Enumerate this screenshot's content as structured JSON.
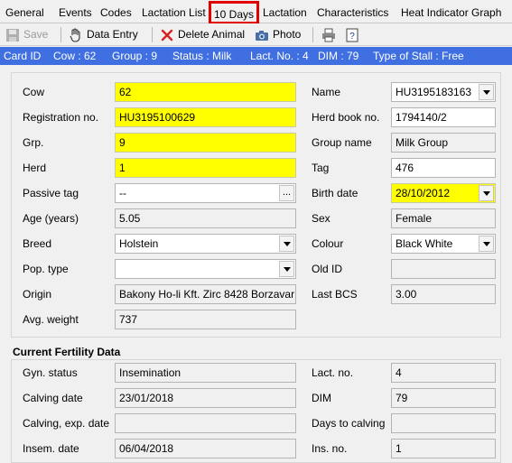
{
  "tabs": [
    "General",
    "Events",
    "Codes",
    "Lactation List",
    "10 Days",
    "Lactation",
    "Characteristics",
    "Heat Indicator Graph"
  ],
  "toolbar": {
    "save": "Save",
    "data_entry": "Data Entry",
    "delete_animal": "Delete Animal",
    "photo": "Photo"
  },
  "infobar": {
    "card_id": "Card ID",
    "cow": "Cow : 62",
    "group": "Group : 9",
    "status": "Status : Milk",
    "lact_no": "Lact. No. : 4",
    "dim": "DIM : 79",
    "stall": "Type of Stall : Free"
  },
  "animal": {
    "cow": {
      "label": "Cow",
      "value": "62"
    },
    "registration": {
      "label": "Registration no.",
      "value": "HU3195100629"
    },
    "grp": {
      "label": "Grp.",
      "value": "9"
    },
    "herd": {
      "label": "Herd",
      "value": "1"
    },
    "passive_tag": {
      "label": "Passive tag",
      "value": "--"
    },
    "age": {
      "label": "Age (years)",
      "value": "5.05"
    },
    "breed": {
      "label": "Breed",
      "value": "Holstein"
    },
    "pop_type": {
      "label": "Pop. type",
      "value": ""
    },
    "origin": {
      "label": "Origin",
      "value": "Bakony Ho-li Kft. Zirc 8428 Borzavar"
    },
    "avg_weight": {
      "label": "Avg. weight",
      "value": "737"
    },
    "name": {
      "label": "Name",
      "value": "HU3195183163"
    },
    "herd_book": {
      "label": "Herd book no.",
      "value": "1794140/2"
    },
    "group_name": {
      "label": "Group name",
      "value": "Milk Group"
    },
    "tag": {
      "label": "Tag",
      "value": "476"
    },
    "birth_date": {
      "label": "Birth date",
      "value": "28/10/2012"
    },
    "sex": {
      "label": "Sex",
      "value": "Female"
    },
    "colour": {
      "label": "Colour",
      "value": "Black White"
    },
    "old_id": {
      "label": "Old ID",
      "value": ""
    },
    "last_bcs": {
      "label": "Last BCS",
      "value": "3.00"
    }
  },
  "fertility": {
    "title": "Current Fertility Data",
    "gyn_status": {
      "label": "Gyn. status",
      "value": "Insemination"
    },
    "calving_date": {
      "label": "Calving date",
      "value": "23/01/2018"
    },
    "calving_exp": {
      "label": "Calving, exp. date",
      "value": ""
    },
    "insem_date": {
      "label": "Insem. date",
      "value": "06/04/2018"
    },
    "lact_no": {
      "label": "Lact. no.",
      "value": "4"
    },
    "dim": {
      "label": "DIM",
      "value": "79"
    },
    "days_to_calving": {
      "label": "Days to calving",
      "value": ""
    },
    "ins_no": {
      "label": "Ins. no.",
      "value": "1"
    }
  },
  "colors": {
    "infobar": "#3f6fe0",
    "highlight": "#ffff00",
    "tab_highlight": "#e00000"
  }
}
